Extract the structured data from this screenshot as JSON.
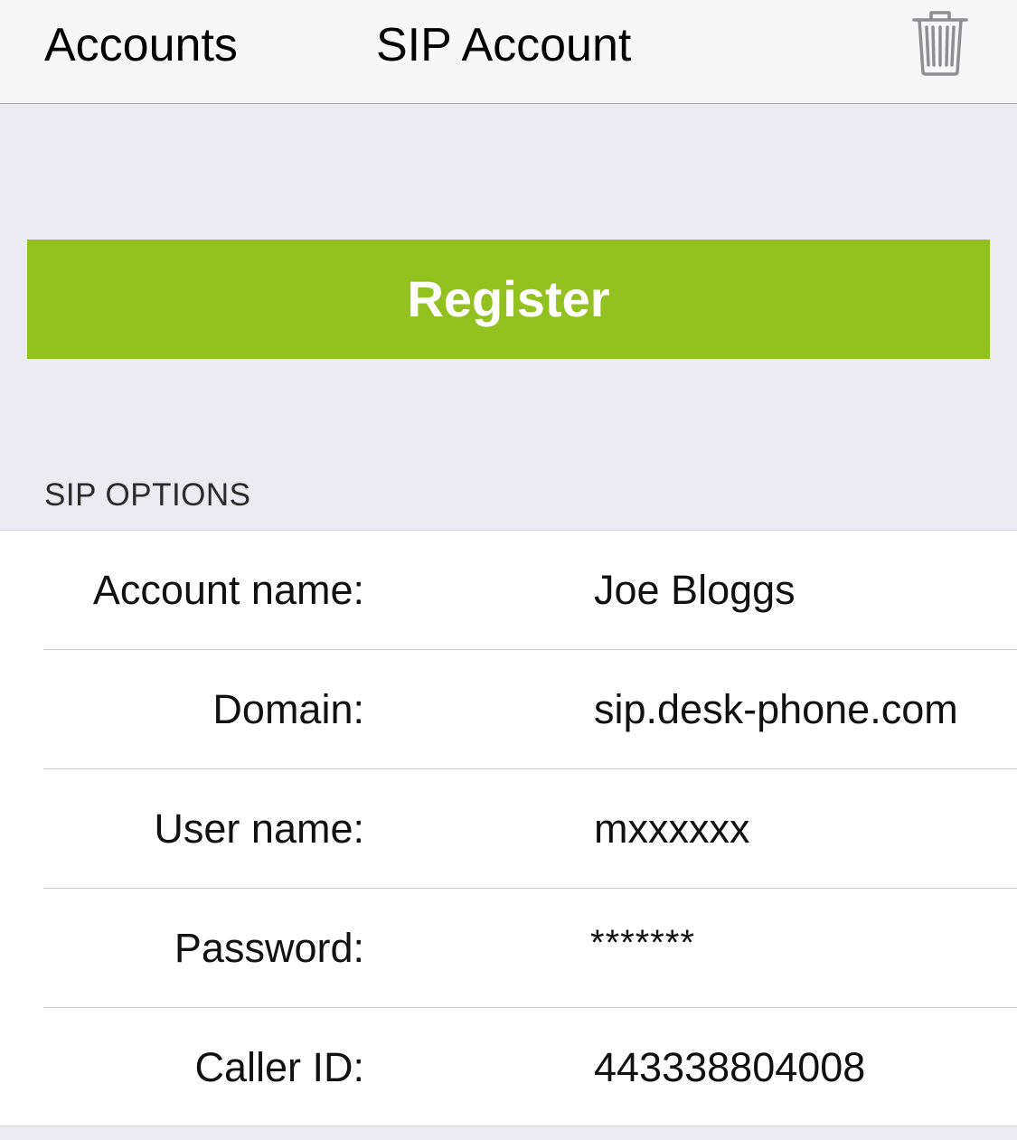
{
  "nav": {
    "back_label": "Accounts",
    "title": "SIP Account",
    "trash_icon": "trash-icon"
  },
  "register_button": {
    "label": "Register",
    "color": "#93c220"
  },
  "sip_options": {
    "header": "SIP OPTIONS",
    "rows": [
      {
        "label": "Account name:",
        "value": "Joe Bloggs"
      },
      {
        "label": "Domain:",
        "value": "sip.desk-phone.com"
      },
      {
        "label": "User name:",
        "value": "mxxxxxx"
      },
      {
        "label": "Password:",
        "value": "*******"
      },
      {
        "label": "Caller ID:",
        "value": "443338804008"
      }
    ]
  }
}
